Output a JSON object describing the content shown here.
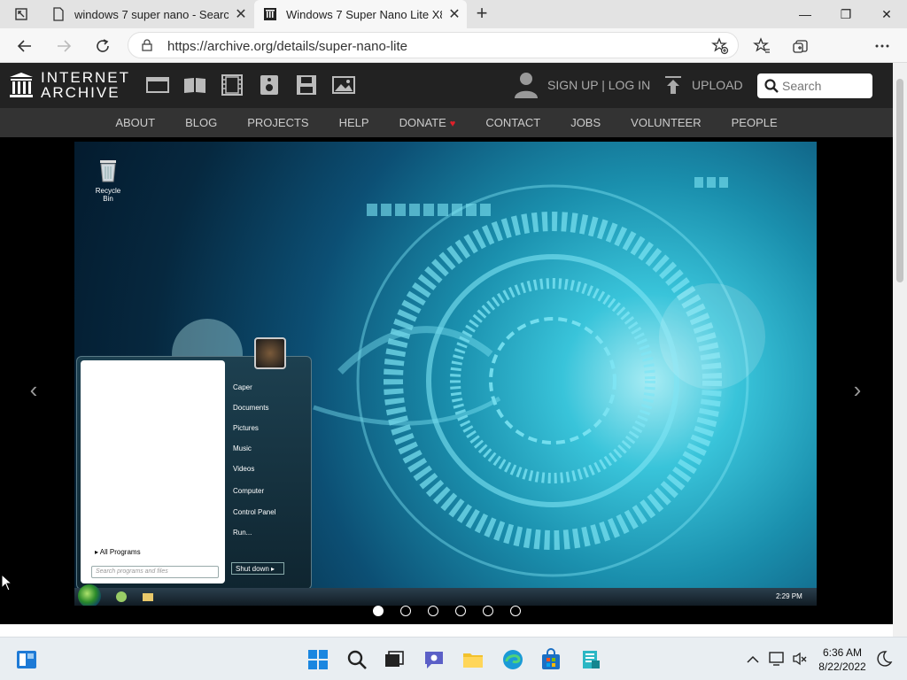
{
  "browser": {
    "tabs": [
      {
        "title": "windows 7 super nano - Search",
        "active": false
      },
      {
        "title": "Windows 7 Super Nano Lite X86",
        "active": true
      }
    ],
    "url": "https://archive.org/details/super-nano-lite",
    "window_controls": {
      "minimize": "—",
      "restore": "❐",
      "close": "✕"
    }
  },
  "ia": {
    "wordmark_line1": "INTERNET",
    "wordmark_line2": "ARCHIVE",
    "signup_label": "SIGN UP | LOG IN",
    "upload_label": "UPLOAD",
    "search_placeholder": "Search",
    "nav": [
      "ABOUT",
      "BLOG",
      "PROJECTS",
      "HELP",
      "DONATE",
      "CONTACT",
      "JOBS",
      "VOLUNTEER",
      "PEOPLE"
    ]
  },
  "viewer": {
    "prev": "‹",
    "next": "›",
    "dots_count": 6,
    "active_dot": 0
  },
  "win7": {
    "recycle_label": "Recycle Bin",
    "start_items": [
      "Caper",
      "Documents",
      "Pictures",
      "Music",
      "Videos",
      "Computer",
      "Control Panel",
      "Run..."
    ],
    "all_programs": "All Programs",
    "search_placeholder": "Search programs and files",
    "shutdown": "Shut down",
    "clock": "2:29 PM"
  },
  "taskbar": {
    "time": "6:36 AM",
    "date": "8/22/2022"
  },
  "colors": {
    "ia_header": "#222222",
    "ia_nav": "#333333",
    "donate_heart": "#e0202a",
    "taskbar": "#e9eef2"
  }
}
